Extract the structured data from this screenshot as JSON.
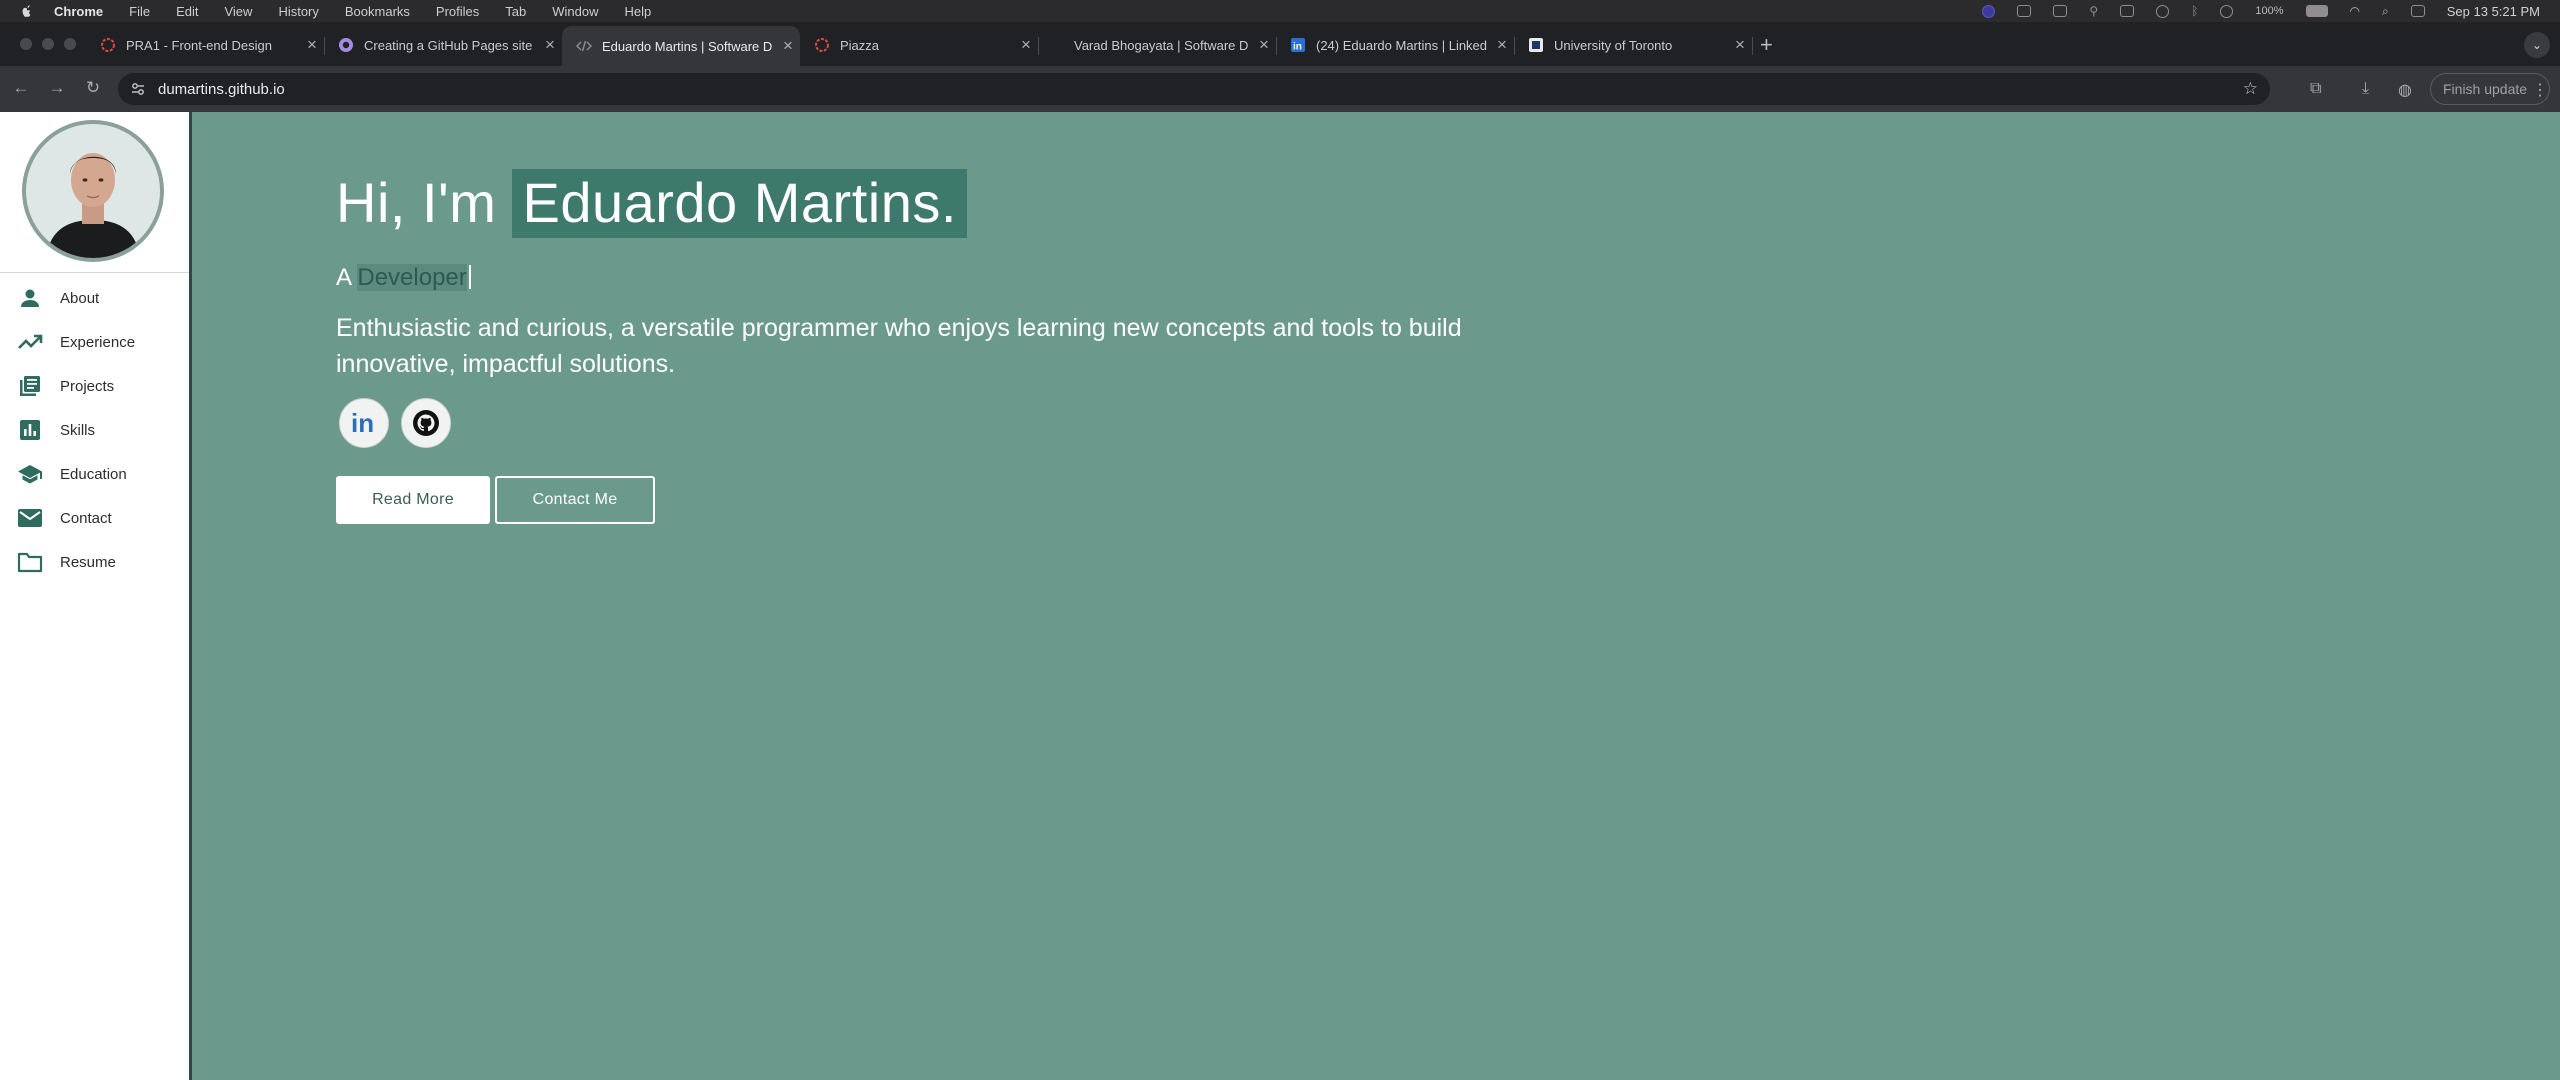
{
  "menubar": {
    "app": "Chrome",
    "items": [
      "File",
      "Edit",
      "View",
      "History",
      "Bookmarks",
      "Profiles",
      "Tab",
      "Window",
      "Help"
    ],
    "battery": "100%",
    "datetime": "Sep 13  5:21 PM"
  },
  "tabs": [
    {
      "title": "PRA1 - Front-end Design",
      "icon": "piazza-icon"
    },
    {
      "title": "Creating a GitHub Pages site",
      "icon": "github-icon"
    },
    {
      "title": "Eduardo Martins | Software D",
      "icon": "code-icon"
    },
    {
      "title": "Piazza",
      "icon": "piazza-icon"
    },
    {
      "title": "Varad Bhogayata | Software D",
      "icon": "blank-icon"
    },
    {
      "title": "(24) Eduardo Martins | Linked",
      "icon": "linkedin-icon"
    },
    {
      "title": "University of Toronto",
      "icon": "uoft-icon"
    }
  ],
  "toolbar": {
    "url": "dumartins.github.io",
    "finish_update": "Finish update"
  },
  "sidebar": {
    "items": [
      {
        "label": "About",
        "icon": "person-icon"
      },
      {
        "label": "Experience",
        "icon": "trending-up-icon"
      },
      {
        "label": "Projects",
        "icon": "library-books-icon"
      },
      {
        "label": "Skills",
        "icon": "bar-chart-icon"
      },
      {
        "label": "Education",
        "icon": "graduation-cap-icon"
      },
      {
        "label": "Contact",
        "icon": "mail-icon"
      },
      {
        "label": "Resume",
        "icon": "folder-icon"
      }
    ]
  },
  "hero": {
    "greeting": "Hi, I'm ",
    "name": "Eduardo Martins.",
    "prefix": "A ",
    "role": "Developer",
    "description": "Enthusiastic and curious, a versatile programmer who enjoys learning new concepts and tools to build innovative, impactful solutions.",
    "read_more": "Read More",
    "contact_me": "Contact Me"
  },
  "colors": {
    "hero_bg": "#6b9a8d",
    "name_highlight": "#3d7a6b",
    "sidebar_icon": "#2f6b5e"
  }
}
